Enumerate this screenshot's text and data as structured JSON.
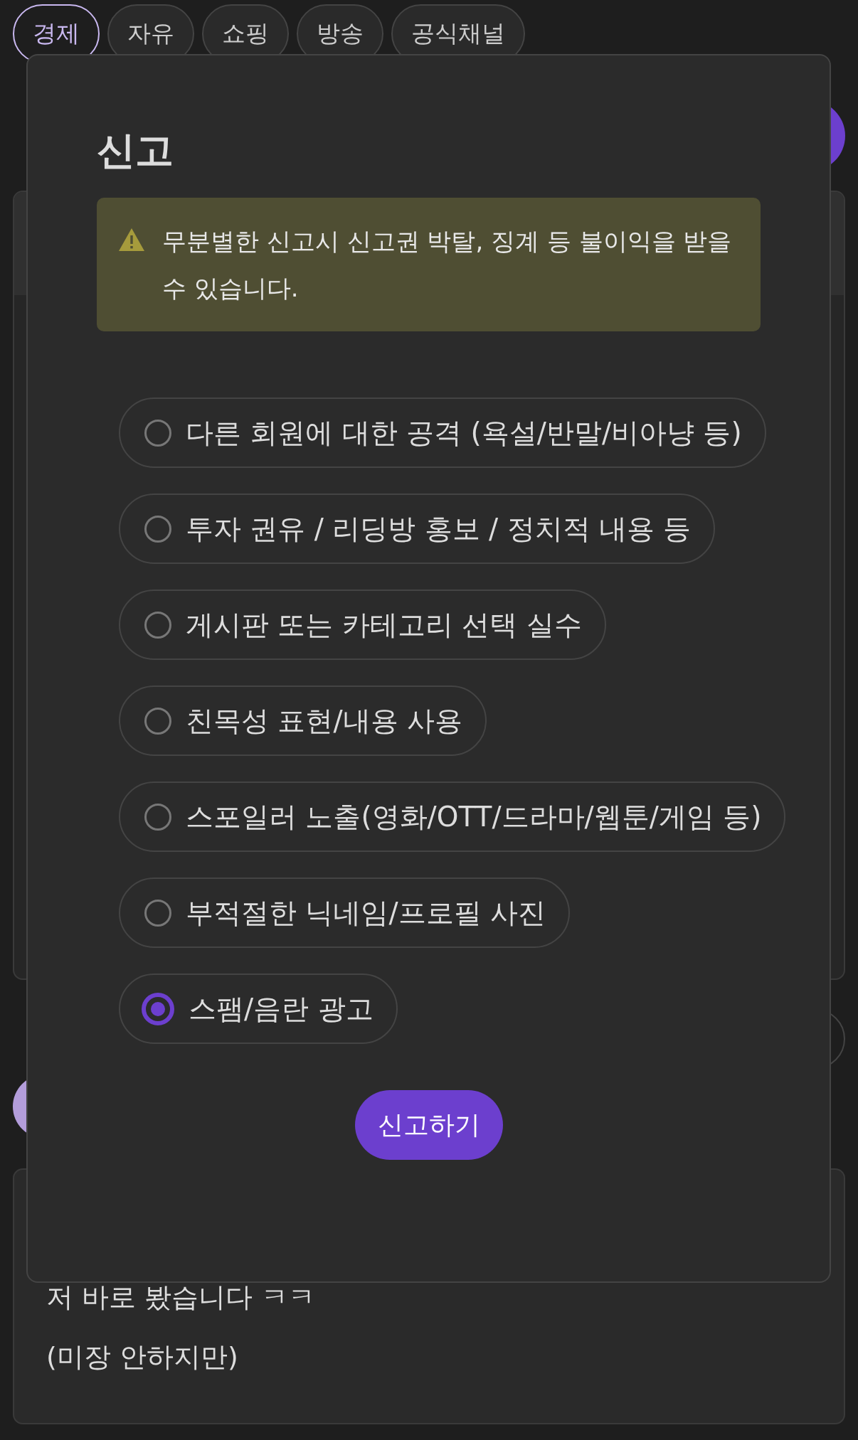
{
  "tabs": [
    {
      "label": "경제",
      "selected": true
    },
    {
      "label": "자유",
      "selected": false
    },
    {
      "label": "쇼핑",
      "selected": false
    },
    {
      "label": "방송",
      "selected": false
    },
    {
      "label": "공식채널",
      "selected": false
    }
  ],
  "dialog": {
    "title": "신고",
    "warning": "무분별한 신고시 신고권 박탈, 징계 등 불이익을 받을 수 있습니다.",
    "options": [
      {
        "label": "다른 회원에 대한 공격 (욕설/반말/비아냥 등)",
        "selected": false
      },
      {
        "label": "투자 권유 / 리딩방 홍보 / 정치적 내용 등",
        "selected": false
      },
      {
        "label": "게시판 또는 카테고리 선택 실수",
        "selected": false
      },
      {
        "label": "친목성 표현/내용 사용",
        "selected": false
      },
      {
        "label": "스포일러 노출(영화/OTT/드라마/웹툰/게임 등)",
        "selected": false
      },
      {
        "label": "부적절한 닉네임/프로필 사진",
        "selected": false
      },
      {
        "label": "스팸/음란 광고",
        "selected": true
      }
    ],
    "submit": "신고하기"
  },
  "comment": {
    "lines": [
      "저 바로 봤습니다 ㅋㅋ",
      "(미장 안하지만)"
    ]
  }
}
